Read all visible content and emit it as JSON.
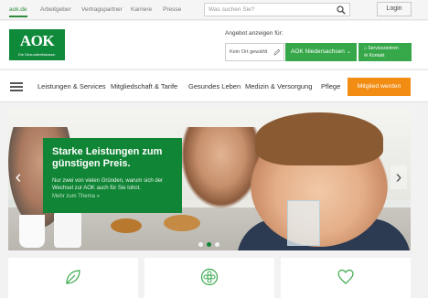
{
  "topbar": {
    "links": [
      "aok.de",
      "Arbeitgeber",
      "Vertragspartner",
      "Karriere",
      "Presse"
    ],
    "search_placeholder": "Was suchen Sie?",
    "login_label": "Login"
  },
  "header": {
    "logo_text": "AOK",
    "logo_claim": "Die Gesundheitskasse.",
    "angebot_label": "Angebot anzeigen für:",
    "ort_label": "Kein Ort gewählt",
    "region_label": "AOK Niedersachsen",
    "service_links": [
      "Servicezentren",
      "Kontakt"
    ]
  },
  "nav": {
    "items": [
      "Leistungen & Services",
      "Mitgliedschaft & Tarife",
      "Gesundes Leben",
      "Medizin & Versorgung",
      "Pflege"
    ],
    "cta_label": "Mitglied werden"
  },
  "hero": {
    "headline": "Starke Leistungen zum günstigen Preis.",
    "text": "Nur zwei von vielen Gründen, warum sich der Wechsel zur AOK auch für Sie lohnt.",
    "more_link": "Mehr zum Thema »",
    "slide_count": 3,
    "active_slide": 1
  },
  "cards": {
    "icons": [
      "leaf-icon",
      "flower-icon",
      "heart-icon"
    ]
  },
  "colors": {
    "brand_green": "#118536",
    "accent_green": "#37a84a",
    "cta_orange": "#f28c13"
  }
}
